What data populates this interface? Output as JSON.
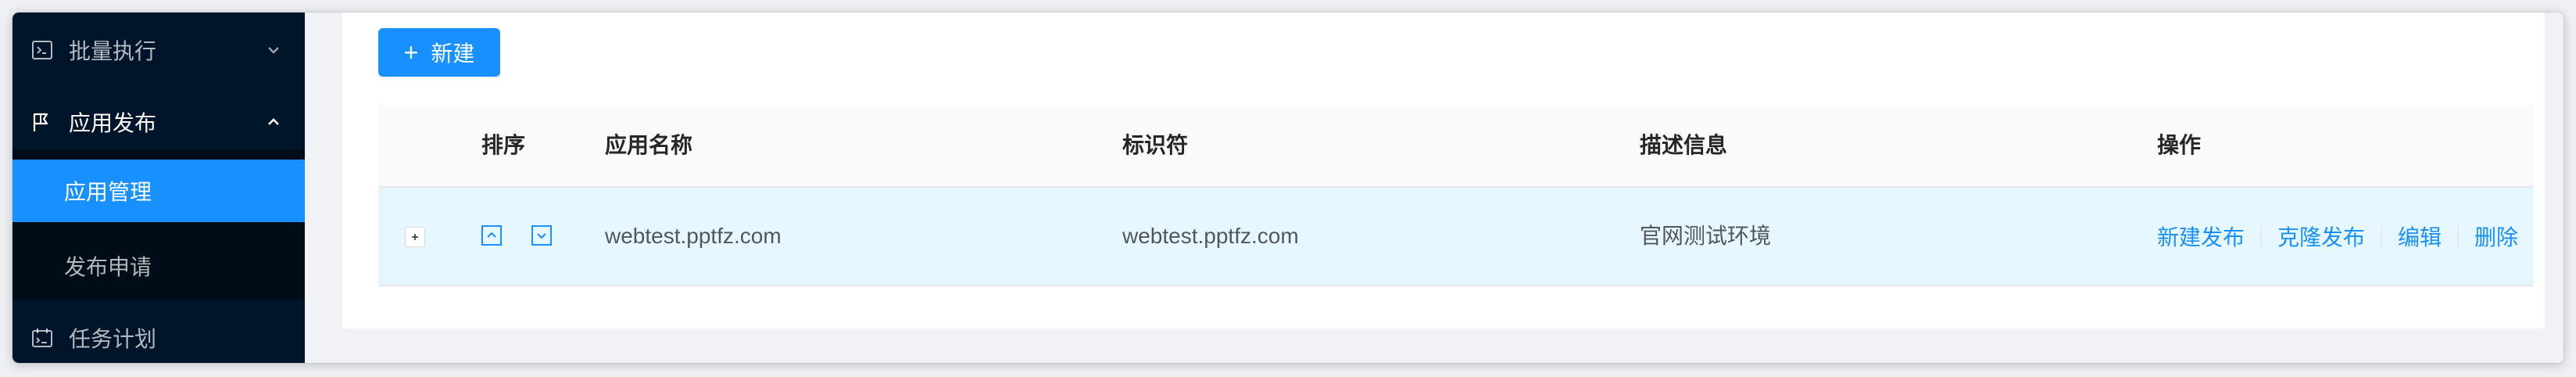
{
  "sidebar": {
    "items": [
      {
        "label": "批量执行",
        "icon": "terminal-icon",
        "expanded": false
      },
      {
        "label": "应用发布",
        "icon": "flag-icon",
        "expanded": true
      },
      {
        "label": "任务计划",
        "icon": "schedule-icon",
        "expanded": false
      }
    ],
    "subitems": [
      {
        "label": "应用管理",
        "selected": true
      },
      {
        "label": "发布申请",
        "selected": false
      }
    ]
  },
  "toolbar": {
    "new_label": "新建"
  },
  "table": {
    "columns": [
      "排序",
      "应用名称",
      "标识符",
      "描述信息",
      "操作"
    ],
    "rows": [
      {
        "name": "webtest.pptfz.com",
        "identifier": "webtest.pptfz.com",
        "description": "官网测试环境",
        "actions": [
          "新建发布",
          "克隆发布",
          "编辑",
          "删除"
        ]
      }
    ]
  },
  "colors": {
    "sidebar_bg": "#001529",
    "submenu_bg": "#000c17",
    "accent": "#1890ff",
    "row_highlight": "#e6f7ff"
  }
}
